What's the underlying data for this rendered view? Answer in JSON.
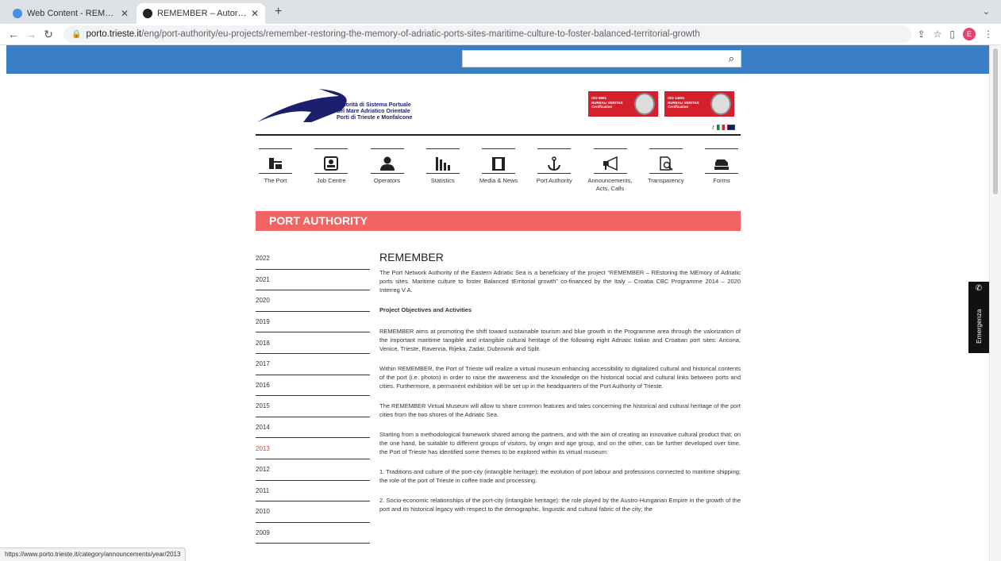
{
  "browser": {
    "tabs": [
      {
        "title": "Web Content - REMEMBER - Il...",
        "active": false
      },
      {
        "title": "REMEMBER – Autorità di Sistem",
        "active": true
      }
    ],
    "new_tab": "+",
    "url_host": "porto.trieste.it",
    "url_path": "/eng/port-authority/eu-projects/remember-restoring-the-memory-of-adriatic-ports-sites-maritime-culture-to-foster-balanced-territorial-growth",
    "avatar_letter": "E",
    "status_url": "https://www.porto.trieste.it/category/announcements/year/2013"
  },
  "header": {
    "logo_lines": [
      "Autorità di Sistema Portuale",
      "del Mare Adriatico Orientale",
      "Porti di Trieste e Monfalcone"
    ],
    "certs": [
      {
        "code": "ISO 9001",
        "name": "BUREAU VERITAS",
        "sub": "Certification"
      },
      {
        "code": "ISO 14001",
        "name": "BUREAU VERITAS",
        "sub": "Certification"
      }
    ]
  },
  "nav": [
    {
      "label": "The Port",
      "icon": "port-crane-icon"
    },
    {
      "label": "Job Centre",
      "icon": "job-centre-icon"
    },
    {
      "label": "Operators",
      "icon": "operator-person-icon"
    },
    {
      "label": "Statistics",
      "icon": "bar-chart-icon"
    },
    {
      "label": "Media & News",
      "icon": "film-icon"
    },
    {
      "label": "Port Authority",
      "icon": "anchor-icon"
    },
    {
      "label": "Announcements, Acts, Calls",
      "icon": "megaphone-icon"
    },
    {
      "label": "Transparency",
      "icon": "document-search-icon"
    },
    {
      "label": "Forms",
      "icon": "stamp-icon"
    }
  ],
  "banner": "PORT AUTHORITY",
  "years": [
    "2022",
    "2021",
    "2020",
    "2019",
    "2018",
    "2017",
    "2016",
    "2015",
    "2014",
    "2013",
    "2012",
    "2011",
    "2010",
    "2009"
  ],
  "selected_year": "2013",
  "article": {
    "title": "REMEMBER",
    "intro": "The Port Network Authority of the Eastern Adriatic Sea is a beneficiary of the project “REMEMBER – REstoring the MEmory of Adriatic ports sites. Maritime culture to foster Balanced tErritorial growth” co-financed by the Italy – Croatia CBC Programme 2014 – 2020 Interreg V A.",
    "subtitle": "Project Objectives and Activities",
    "p1": "REMEMBER aims at promoting the shift toward sustainable tourism and blue growth in the Programme area through the valorization of the important maritime tangible and intangible cultural heritage of the following eight Adriatic Italian and Croatian port sites: Ancona, Venice, Trieste, Ravenna, Rijeka, Zadar, Dubrovnik and Split.",
    "p2": "Within REMEMBER, the Port of Trieste will realize a virtual museum enhancing accessibility to digitalized cultural and historical contents of the port (i.e. photos) in order to raise the awareness and the knowledge on the historical social and cultural links between ports and cities. Furthermore, a permanent exhibition will be set up in the headquarters of the Port Authority of Trieste.",
    "p3": "The REMEMBER Virtual Museum will allow to share common features and tales concerning the historical and cultural heritage of the port cities from the two shores of the Adriatic Sea.",
    "p4": "Starting from a methodological framework shared among the partners, and with the aim of creating an innovative cultural product that, on the one hand, be suitable to different groups of visitors, by origin and age group, and on the other, can be further developed over time, the Port of Trieste has identified some themes to be explored within its virtual museum:",
    "p5": "1. Traditions and culture of the port-city (intangible heritage): the evolution of port labour and professions connected to maritime shipping; the role of the port of Trieste in coffee trade and processing.",
    "p6": "2. Socio-economic relationships of the port-city (intangible heritage): the role played by the Austro-Hungarian Empire in the growth of the port and its historical legacy with respect to the demographic, linguistic and cultural fabric of the city; the"
  },
  "emergency": "Emergenza"
}
